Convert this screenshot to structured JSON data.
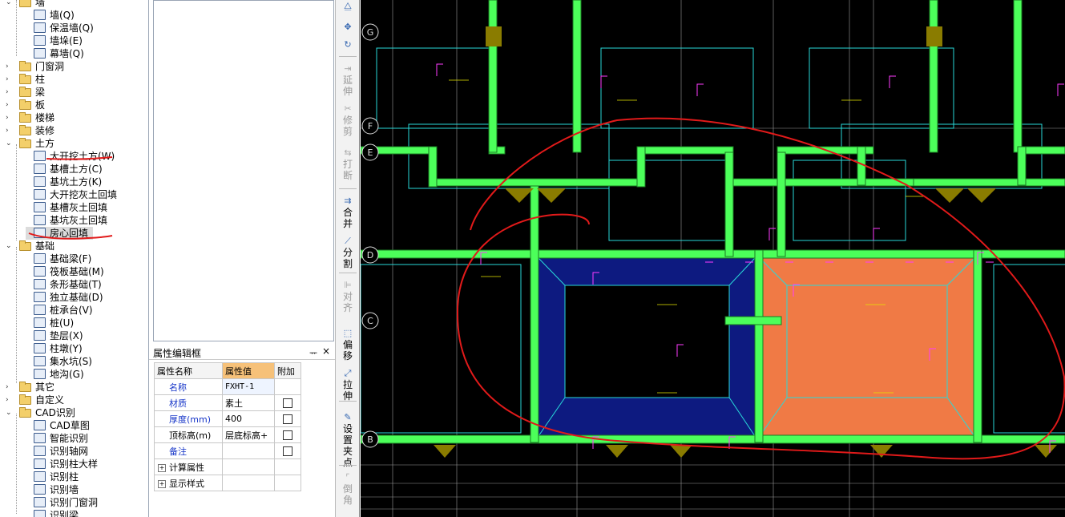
{
  "tree": {
    "items": [
      {
        "label": "墙",
        "level": 0,
        "type": "folder",
        "expanded": true
      },
      {
        "label": "墙(Q)",
        "level": 1,
        "type": "leaf",
        "icon": "wall-icon"
      },
      {
        "label": "保温墙(Q)",
        "level": 1,
        "type": "leaf",
        "icon": "insulation-wall-icon"
      },
      {
        "label": "墙垛(E)",
        "level": 1,
        "type": "leaf",
        "icon": "wall-pier-icon"
      },
      {
        "label": "幕墙(Q)",
        "level": 1,
        "type": "leaf",
        "icon": "curtain-wall-icon"
      },
      {
        "label": "门窗洞",
        "level": 0,
        "type": "folder",
        "expanded": false
      },
      {
        "label": "柱",
        "level": 0,
        "type": "folder",
        "expanded": false
      },
      {
        "label": "梁",
        "level": 0,
        "type": "folder",
        "expanded": false
      },
      {
        "label": "板",
        "level": 0,
        "type": "folder",
        "expanded": false
      },
      {
        "label": "楼梯",
        "level": 0,
        "type": "folder",
        "expanded": false
      },
      {
        "label": "装修",
        "level": 0,
        "type": "folder",
        "expanded": false
      },
      {
        "label": "土方",
        "level": 0,
        "type": "folder",
        "expanded": true
      },
      {
        "label": "大开挖土方(W)",
        "level": 1,
        "type": "leaf",
        "icon": "excavation-icon"
      },
      {
        "label": "基槽土方(C)",
        "level": 1,
        "type": "leaf",
        "icon": "trench-icon"
      },
      {
        "label": "基坑土方(K)",
        "level": 1,
        "type": "leaf",
        "icon": "pit-icon"
      },
      {
        "label": "大开挖灰土回填",
        "level": 1,
        "type": "leaf",
        "icon": "backfill-icon"
      },
      {
        "label": "基槽灰土回填",
        "level": 1,
        "type": "leaf",
        "icon": "trench-backfill-icon"
      },
      {
        "label": "基坑灰土回填",
        "level": 1,
        "type": "leaf",
        "icon": "pit-backfill-icon"
      },
      {
        "label": "房心回填",
        "level": 1,
        "type": "leaf",
        "icon": "room-backfill-icon",
        "selected": true
      },
      {
        "label": "基础",
        "level": 0,
        "type": "folder",
        "expanded": true
      },
      {
        "label": "基础梁(F)",
        "level": 1,
        "type": "leaf",
        "icon": "foundation-beam-icon"
      },
      {
        "label": "筏板基础(M)",
        "level": 1,
        "type": "leaf",
        "icon": "raft-foundation-icon"
      },
      {
        "label": "条形基础(T)",
        "level": 1,
        "type": "leaf",
        "icon": "strip-foundation-icon"
      },
      {
        "label": "独立基础(D)",
        "level": 1,
        "type": "leaf",
        "icon": "isolated-foundation-icon"
      },
      {
        "label": "桩承台(V)",
        "level": 1,
        "type": "leaf",
        "icon": "pile-cap-icon"
      },
      {
        "label": "桩(U)",
        "level": 1,
        "type": "leaf",
        "icon": "pile-icon"
      },
      {
        "label": "垫层(X)",
        "level": 1,
        "type": "leaf",
        "icon": "cushion-icon"
      },
      {
        "label": "柱墩(Y)",
        "level": 1,
        "type": "leaf",
        "icon": "column-pier-icon"
      },
      {
        "label": "集水坑(S)",
        "level": 1,
        "type": "leaf",
        "icon": "sump-icon"
      },
      {
        "label": "地沟(G)",
        "level": 1,
        "type": "leaf",
        "icon": "ditch-icon"
      },
      {
        "label": "其它",
        "level": 0,
        "type": "folder",
        "expanded": false
      },
      {
        "label": "自定义",
        "level": 0,
        "type": "folder",
        "expanded": false
      },
      {
        "label": "CAD识别",
        "level": 0,
        "type": "folder",
        "expanded": true
      },
      {
        "label": "CAD草图",
        "level": 1,
        "type": "leaf",
        "icon": "cad-sketch-icon"
      },
      {
        "label": "智能识别",
        "level": 1,
        "type": "leaf",
        "icon": "smart-recognize-icon"
      },
      {
        "label": "识别轴网",
        "level": 1,
        "type": "leaf",
        "icon": "recognize-grid-icon"
      },
      {
        "label": "识别柱大样",
        "level": 1,
        "type": "leaf",
        "icon": "recognize-column-detail-icon"
      },
      {
        "label": "识别柱",
        "level": 1,
        "type": "leaf",
        "icon": "recognize-column-icon"
      },
      {
        "label": "识别墙",
        "level": 1,
        "type": "leaf",
        "icon": "recognize-wall-icon"
      },
      {
        "label": "识别门窗洞",
        "level": 1,
        "type": "leaf",
        "icon": "recognize-opening-icon"
      },
      {
        "label": "识别梁",
        "level": 1,
        "type": "leaf",
        "icon": "recognize-beam-icon"
      }
    ]
  },
  "props": {
    "title": "属性编辑框",
    "pin": "ᅲ",
    "close": "×",
    "headers": {
      "name": "属性名称",
      "value": "属性值",
      "extra": "附加"
    },
    "rows": [
      {
        "name": "名称",
        "value": "FXHT-1",
        "blue": true,
        "check": false
      },
      {
        "name": "材质",
        "value": "素土",
        "blue": true,
        "check": true
      },
      {
        "name": "厚度(mm)",
        "value": "400",
        "blue": true,
        "check": true
      },
      {
        "name": "顶标高(m)",
        "value": "层底标高+",
        "blue": false,
        "check": true
      },
      {
        "name": "备注",
        "value": "",
        "blue": true,
        "check": true
      }
    ],
    "groups": [
      "计算属性",
      "显示样式"
    ]
  },
  "toolbar": {
    "buttons": [
      {
        "label": "",
        "icon": "mirror-icon",
        "enabled": true
      },
      {
        "label": "",
        "icon": "move-icon",
        "enabled": true
      },
      {
        "label": "",
        "icon": "rotate-icon",
        "enabled": true
      },
      {
        "label": "延伸",
        "icon": "extend-icon",
        "enabled": false
      },
      {
        "label": "修剪",
        "icon": "trim-icon",
        "enabled": false
      },
      {
        "label": "打断",
        "icon": "break-icon",
        "enabled": false
      },
      {
        "label": "合并",
        "icon": "merge-icon",
        "enabled": true
      },
      {
        "label": "分割",
        "icon": "split-icon",
        "enabled": true
      },
      {
        "label": "对齐",
        "icon": "align-icon",
        "enabled": false
      },
      {
        "label": "偏移",
        "icon": "offset-icon",
        "enabled": true
      },
      {
        "label": "拉伸",
        "icon": "stretch-icon",
        "enabled": true
      },
      {
        "label": "设置夹点",
        "icon": "grip-icon",
        "enabled": true
      },
      {
        "label": "倒角",
        "icon": "chamfer-icon",
        "enabled": false
      }
    ]
  },
  "canvas": {
    "axis_labels": [
      "G",
      "F",
      "E",
      "D",
      "C",
      "B"
    ],
    "colors": {
      "beam": "#4cff5a",
      "cyan": "#29d9d9",
      "navy": "#0d1a80",
      "orange": "#f07a45",
      "annotation": "#e11a1a",
      "magenta": "#ff3cff"
    }
  }
}
